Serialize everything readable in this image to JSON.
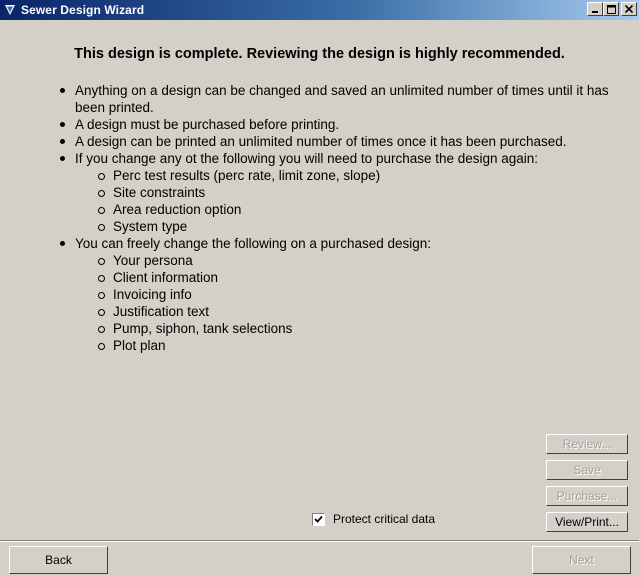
{
  "window": {
    "title": "Sewer Design Wizard",
    "minimize_label": "_",
    "maximize_label": "□",
    "close_label": "×"
  },
  "heading": "This design is complete. Reviewing the design is highly recommended.",
  "bullets": [
    "Anything on a design can be changed and saved an unlimited number of times until it has been printed.",
    "A design must be purchased before printing.",
    "A design can be printed an unlimited number of times once it has been purchased.",
    "If you change any ot the following you will need to purchase the design again:"
  ],
  "purchase_again_items": [
    "Perc test results (perc rate, limit zone, slope)",
    "Site constraints",
    "Area reduction option",
    "System type"
  ],
  "free_change_intro": "You can freely change the following on a purchased design:",
  "free_change_items": [
    "Your persona",
    "Client information",
    "Invoicing info",
    "Justification text",
    "Pump, siphon, tank selections",
    "Plot plan"
  ],
  "side_buttons": {
    "review": "Review...",
    "save": "Save",
    "purchase": "Purchase...",
    "view_print": "View/Print..."
  },
  "checkbox": {
    "label": "Protect critical data",
    "checked": true
  },
  "nav": {
    "back": "Back",
    "next": "Next"
  }
}
